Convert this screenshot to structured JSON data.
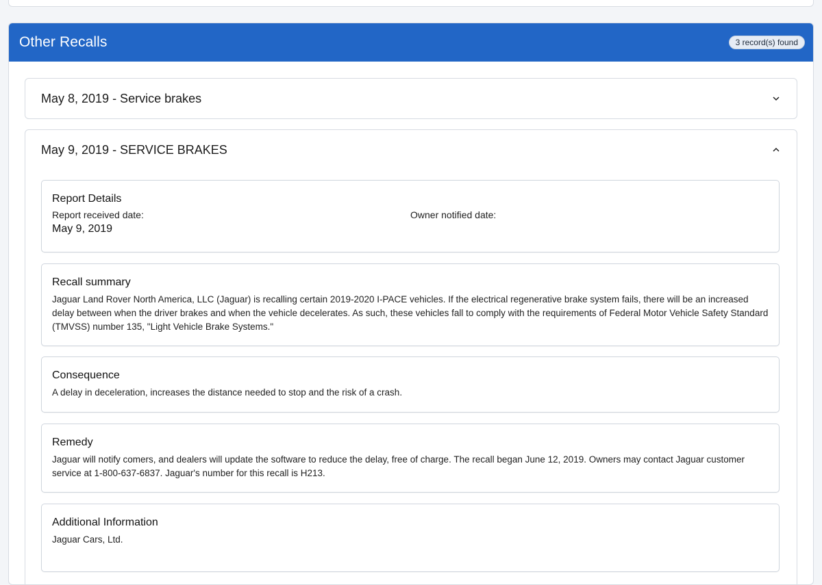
{
  "panel": {
    "title": "Other Recalls",
    "badge": "3 record(s) found"
  },
  "recalls": [
    {
      "title": "May 8, 2019 - Service brakes",
      "expanded": false
    },
    {
      "title": "May 9, 2019 - SERVICE BRAKES",
      "expanded": true,
      "report_details": {
        "heading": "Report Details",
        "received_label": "Report received date:",
        "received_value": "May 9, 2019",
        "owner_label": "Owner notified date:",
        "owner_value": ""
      },
      "summary": {
        "heading": "Recall summary",
        "text": "Jaguar Land Rover North America, LLC (Jaguar) is recalling certain 2019-2020 I-PACE vehicles. If the electrical regenerative brake system fails, there will be an increased delay between when the driver brakes and when the vehicle decelerates. As such, these vehicles fall to comply with the requirements of Federal Motor Vehicle Safety Standard (TMVSS) number 135, \"Light Vehicle Brake Systems.\""
      },
      "consequence": {
        "heading": "Consequence",
        "text": "A delay in deceleration, increases the distance needed to stop and the risk of a crash."
      },
      "remedy": {
        "heading": "Remedy",
        "text": "Jaguar will notify comers, and dealers will update the software to reduce the delay, free of charge. The recall began June 12, 2019. Owners may contact Jaguar customer service at 1-800-637-6837. Jaguar's number for this recall is H213."
      },
      "additional": {
        "heading": "Additional Information",
        "text": "Jaguar Cars, Ltd."
      }
    }
  ],
  "icons": {
    "collapsed": "chevron-down-icon",
    "expanded": "chevron-up-icon"
  },
  "colors": {
    "header_bg": "#2266c6",
    "header_text": "#ffffff",
    "badge_bg": "#e6ecf5"
  }
}
